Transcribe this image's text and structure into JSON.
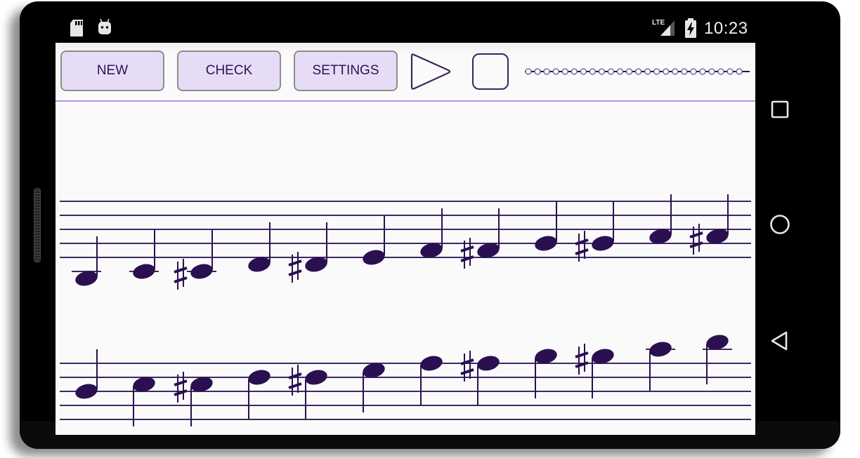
{
  "status_bar": {
    "left_icons": [
      "sd-card-icon",
      "android-debug-icon"
    ],
    "network_label": "LTE",
    "battery_state": "charging",
    "time": "10:23"
  },
  "toolbar": {
    "new_label": "NEW",
    "check_label": "CHECK",
    "settings_label": "SETTINGS",
    "play_icon": "play-icon",
    "stop_icon": "stop-icon"
  },
  "progress": {
    "total_steps": 24,
    "completed_steps": 0
  },
  "colors": {
    "ink": "#2a1050",
    "staff_line": "#3d2864",
    "button_fill": "#e6dcf6",
    "button_border": "#8c8c8c",
    "divider": "#b98ce6",
    "screen_bg": "#fafafa",
    "progress_dot_stroke": "#6a5590"
  },
  "score": {
    "staves": [
      {
        "notes": [
          {
            "step": -3,
            "sharp": false,
            "stem": "up"
          },
          {
            "step": -2,
            "sharp": false,
            "stem": "up"
          },
          {
            "step": -2,
            "sharp": true,
            "stem": "up"
          },
          {
            "step": -1,
            "sharp": false,
            "stem": "up"
          },
          {
            "step": -1,
            "sharp": true,
            "stem": "up"
          },
          {
            "step": 0,
            "sharp": false,
            "stem": "up"
          },
          {
            "step": 1,
            "sharp": false,
            "stem": "up"
          },
          {
            "step": 1,
            "sharp": true,
            "stem": "up"
          },
          {
            "step": 2,
            "sharp": false,
            "stem": "up"
          },
          {
            "step": 2,
            "sharp": true,
            "stem": "up"
          },
          {
            "step": 3,
            "sharp": false,
            "stem": "up"
          },
          {
            "step": 3,
            "sharp": true,
            "stem": "up"
          }
        ]
      },
      {
        "notes": [
          {
            "step": 4,
            "sharp": false,
            "stem": "up"
          },
          {
            "step": 5,
            "sharp": false,
            "stem": "down"
          },
          {
            "step": 5,
            "sharp": true,
            "stem": "down"
          },
          {
            "step": 6,
            "sharp": false,
            "stem": "down"
          },
          {
            "step": 6,
            "sharp": true,
            "stem": "down"
          },
          {
            "step": 7,
            "sharp": false,
            "stem": "down"
          },
          {
            "step": 8,
            "sharp": false,
            "stem": "down"
          },
          {
            "step": 8,
            "sharp": true,
            "stem": "down"
          },
          {
            "step": 9,
            "sharp": false,
            "stem": "down"
          },
          {
            "step": 9,
            "sharp": true,
            "stem": "down"
          },
          {
            "step": 10,
            "sharp": false,
            "stem": "down"
          },
          {
            "step": 11,
            "sharp": false,
            "stem": "down"
          }
        ]
      }
    ]
  },
  "nav_bar": {
    "items": [
      "recents-icon",
      "home-icon",
      "back-icon"
    ]
  }
}
